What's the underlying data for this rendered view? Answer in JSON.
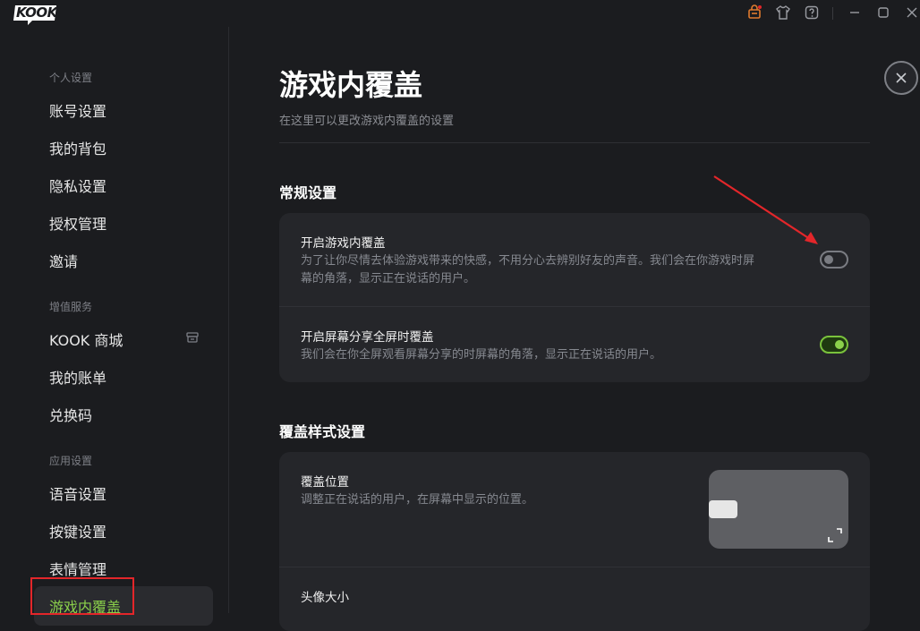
{
  "app": {
    "logo_text": "KOOK"
  },
  "titlebar": {
    "icons": [
      "shop-bag-icon",
      "shirt-icon",
      "help-icon",
      "minimize-icon",
      "maximize-icon",
      "close-icon"
    ]
  },
  "sidebar": {
    "sections": [
      {
        "label": "个人设置",
        "items": [
          "账号设置",
          "我的背包",
          "隐私设置",
          "授权管理",
          "邀请"
        ]
      },
      {
        "label": "增值服务",
        "items": [
          "KOOK 商城",
          "我的账单",
          "兑换码"
        ]
      },
      {
        "label": "应用设置",
        "items": [
          "语音设置",
          "按键设置",
          "表情管理",
          "游戏内覆盖"
        ]
      }
    ],
    "active_item": "游戏内覆盖"
  },
  "main": {
    "title": "游戏内覆盖",
    "subtitle": "在这里可以更改游戏内覆盖的设置",
    "general": {
      "heading": "常规设置",
      "rows": [
        {
          "title": "开启游戏内覆盖",
          "desc_line1": "为了让你尽情去体验游戏带来的快感，不用分心去辨别好友的声音。我们会在你游戏时屏",
          "desc_line2": "幕的角落，显示正在说话的用户。",
          "toggle": "off"
        },
        {
          "title": "开启屏幕分享全屏时覆盖",
          "desc_line1": "我们会在你全屏观看屏幕分享的时屏幕的角落，显示正在说话的用户。",
          "toggle": "on"
        }
      ]
    },
    "style": {
      "heading": "覆盖样式设置",
      "position_title": "覆盖位置",
      "position_desc": "调整正在说话的用户，在屏幕中显示的位置。",
      "avatar_size_title": "头像大小"
    }
  },
  "colors": {
    "accent": "#8bd14b",
    "annotation": "#e3262a",
    "background": "#1b1c1f",
    "card": "#25262a"
  }
}
